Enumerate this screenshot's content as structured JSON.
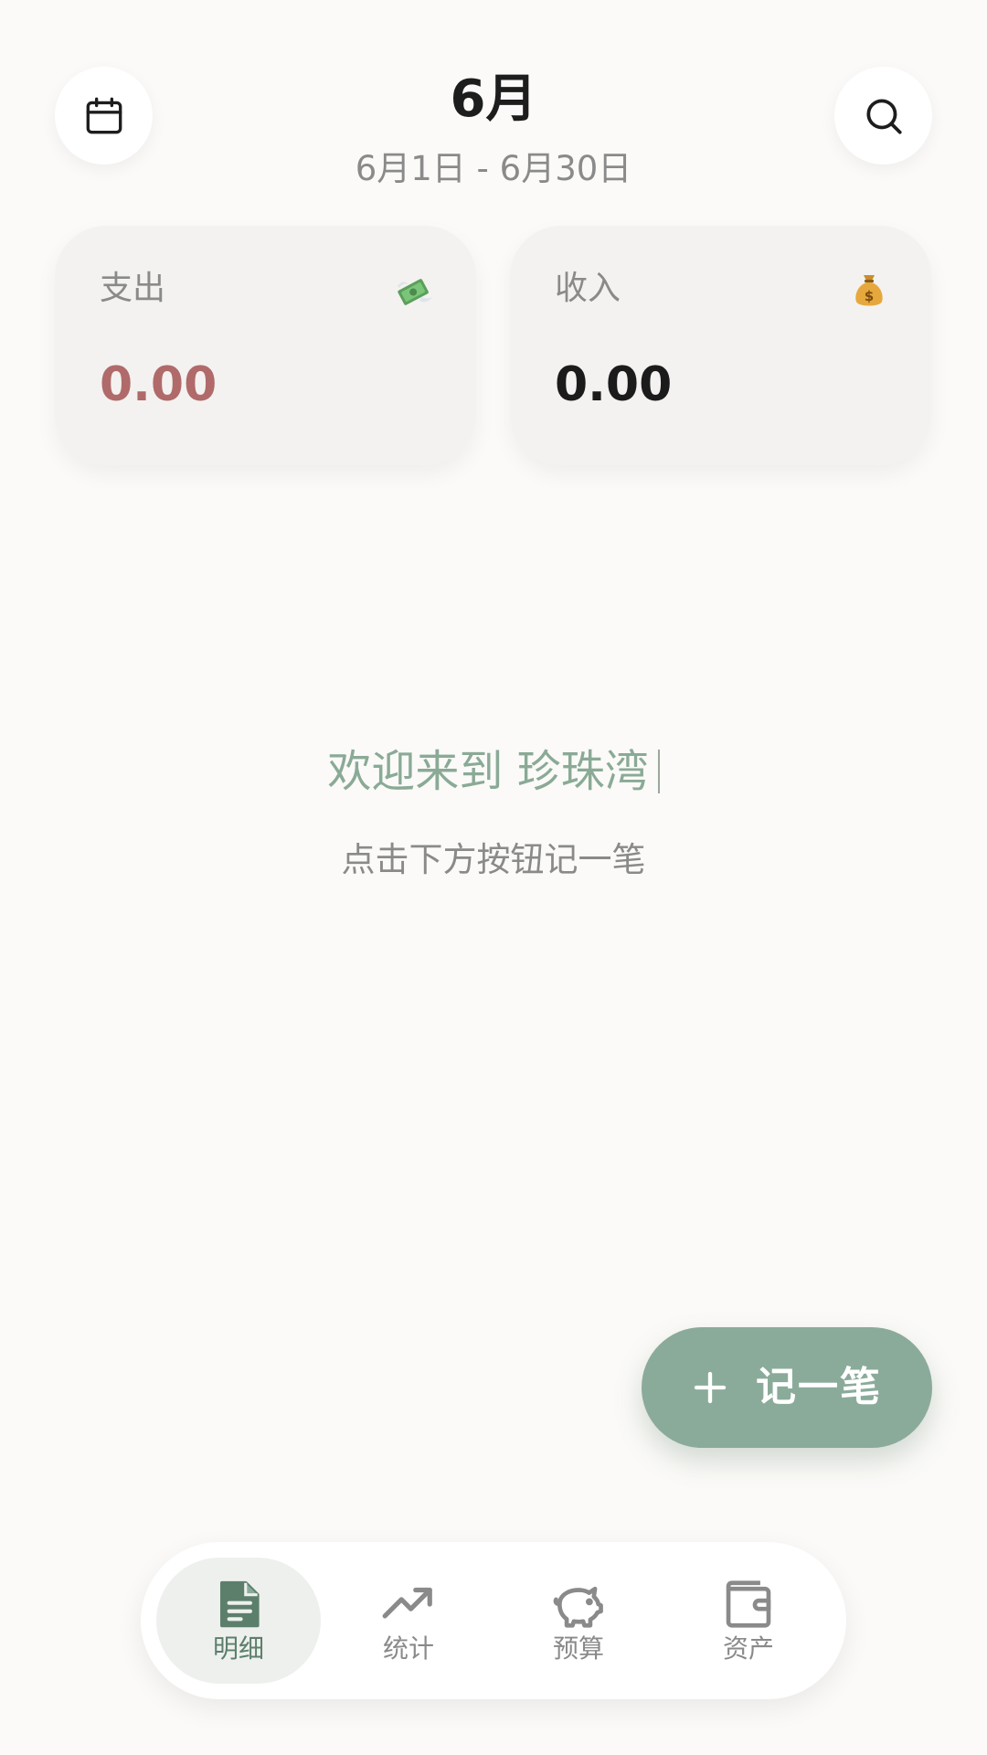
{
  "header": {
    "month": "6月",
    "range": "6月1日 - 6月30日"
  },
  "summary": {
    "expense": {
      "label": "支出",
      "value": "0.00",
      "icon": "flying-money-icon"
    },
    "income": {
      "label": "收入",
      "value": "0.00",
      "icon": "money-bag-icon"
    }
  },
  "empty_state": {
    "welcome": "欢迎来到 珍珠湾",
    "hint": "点击下方按钮记一笔"
  },
  "fab": {
    "label": "记一笔"
  },
  "nav": {
    "items": [
      {
        "label": "明细",
        "icon": "document-icon",
        "active": true
      },
      {
        "label": "统计",
        "icon": "trend-up-icon",
        "active": false
      },
      {
        "label": "预算",
        "icon": "piggy-bank-icon",
        "active": false
      },
      {
        "label": "资产",
        "icon": "wallet-icon",
        "active": false
      }
    ]
  },
  "colors": {
    "accent": "#8bab9a",
    "accent_dark": "#5c7f6c",
    "expense": "#b06a6a",
    "muted": "#8a8a8a",
    "background": "#fbfaf8"
  }
}
